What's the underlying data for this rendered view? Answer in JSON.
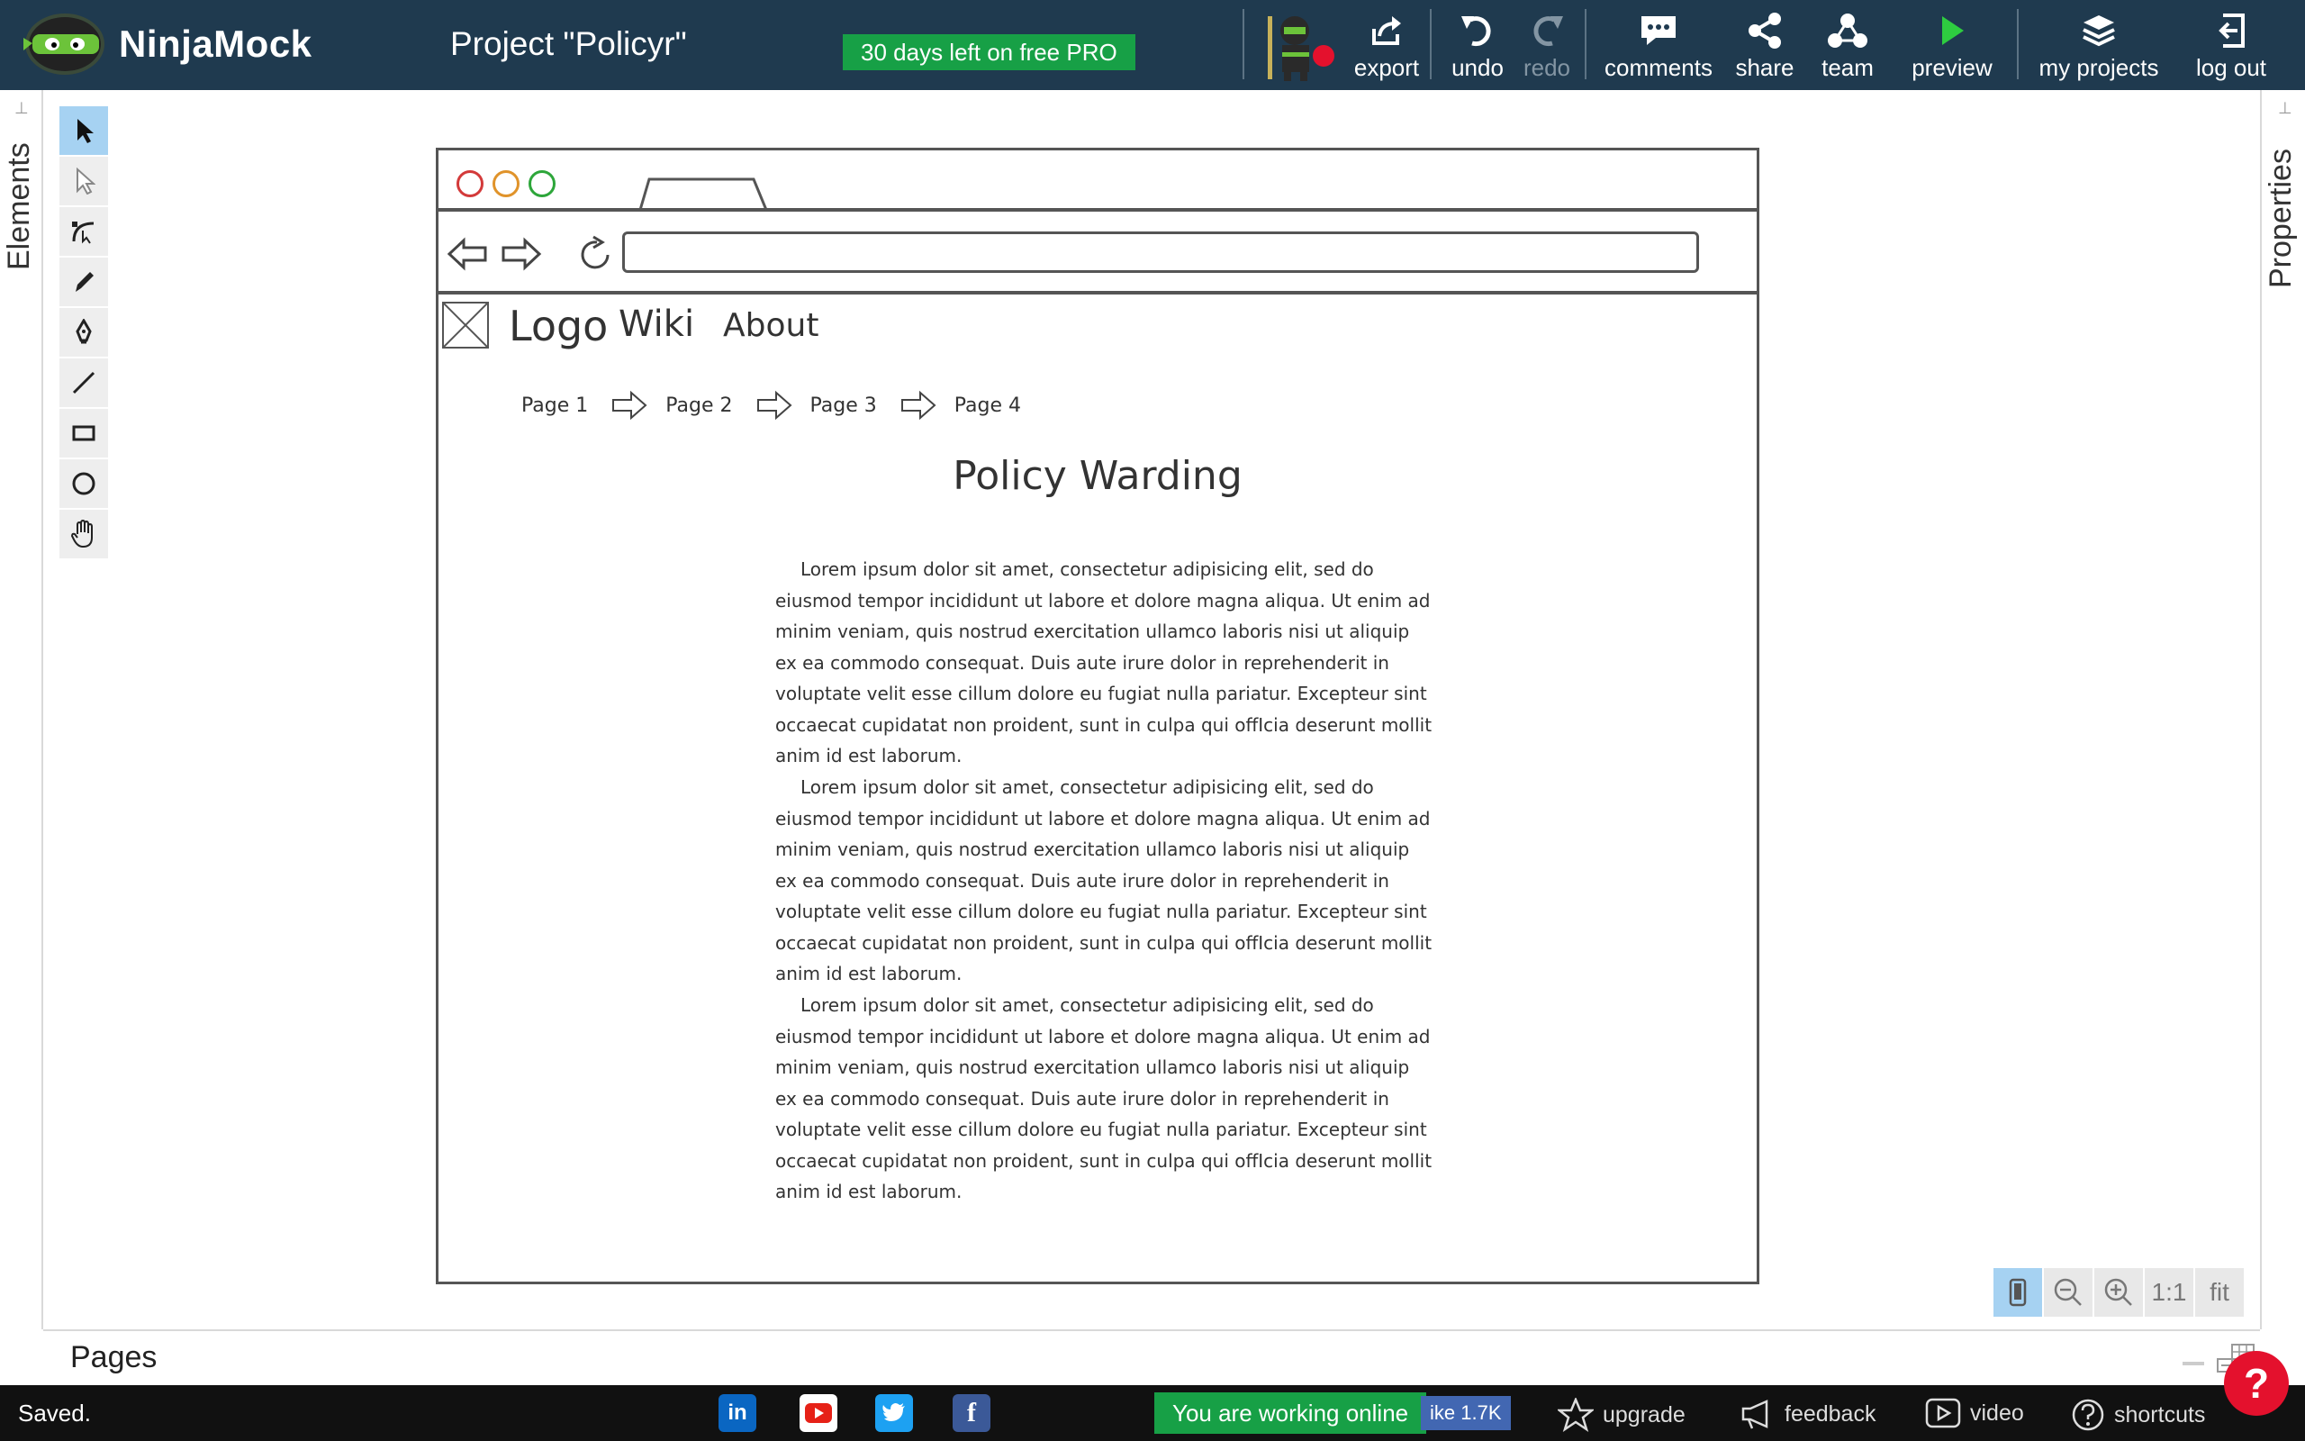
{
  "app": {
    "name": "NinjaMock",
    "project_title": "Project \"Policyr\"",
    "trial_badge": "30 days left on free PRO"
  },
  "toolbar": {
    "export": "export",
    "undo": "undo",
    "redo": "redo",
    "comments": "comments",
    "share": "share",
    "team": "team",
    "preview": "preview",
    "my_projects": "my projects",
    "log_out": "log out"
  },
  "side_panels": {
    "elements": "Elements",
    "properties": "Properties",
    "pages": "Pages"
  },
  "mock": {
    "nav": {
      "logo": "Logo",
      "wiki": "Wiki",
      "about": "About"
    },
    "breadcrumbs": [
      "Page 1",
      "Page 2",
      "Page 3",
      "Page 4"
    ],
    "heading": "Policy Warding",
    "paragraphs": [
      "Lorem ipsum dolor sit amet, consectetur adipisicing elit, sed do eiusmod tempor incididunt ut labore et dolore magna aliqua. Ut enim ad minim veniam, quis nostrud exercitation ullamco laboris nisi ut aliquip ex ea commodo consequat. Duis aute irure dolor in reprehenderit in voluptate velit esse cillum dolore eu fugiat nulla pariatur. Excepteur sint occaecat cupidatat non proident, sunt in culpa qui offIcia deserunt mollit anim id est laborum.",
      "Lorem ipsum dolor sit amet, consectetur adipisicing elit, sed do eiusmod tempor incididunt ut labore et dolore magna aliqua. Ut enim ad minim veniam, quis nostrud exercitation ullamco laboris nisi ut aliquip ex ea commodo consequat. Duis aute irure dolor in reprehenderit in voluptate velit esse cillum dolore eu fugiat nulla pariatur. Excepteur sint occaecat cupidatat non proident, sunt in culpa qui offIcia deserunt mollit anim id est laborum.",
      "Lorem ipsum dolor sit amet, consectetur adipisicing elit, sed do eiusmod tempor incididunt ut labore et dolore magna aliqua. Ut enim ad minim veniam, quis nostrud exercitation ullamco laboris nisi ut aliquip ex ea commodo consequat. Duis aute irure dolor in reprehenderit in voluptate velit esse cillum dolore eu fugiat nulla pariatur. Excepteur sint occaecat cupidatat non proident, sunt in culpa qui offIcia deserunt mollit anim id est laborum."
    ]
  },
  "zoom": {
    "one_to_one": "1:1",
    "fit": "fit"
  },
  "statusbar": {
    "saved": "Saved.",
    "online": "You are working online",
    "like": "ike 1.7K",
    "upgrade": "upgrade",
    "feedback": "feedback",
    "video": "video",
    "shortcuts": "shortcuts",
    "help": "?"
  },
  "colors": {
    "topbar": "#1f3a4f",
    "accent_green": "#17a046",
    "record_red": "#e4112d",
    "tool_active": "#a6d2f2"
  },
  "icons": [
    "ninja-logo-icon",
    "export-icon",
    "undo-icon",
    "redo-icon",
    "comments-icon",
    "share-icon",
    "team-icon",
    "preview-icon",
    "my-projects-icon",
    "log-out-icon",
    "linkedin-icon",
    "youtube-icon",
    "twitter-icon",
    "facebook-icon",
    "star-icon",
    "megaphone-icon",
    "play-icon",
    "question-icon"
  ]
}
